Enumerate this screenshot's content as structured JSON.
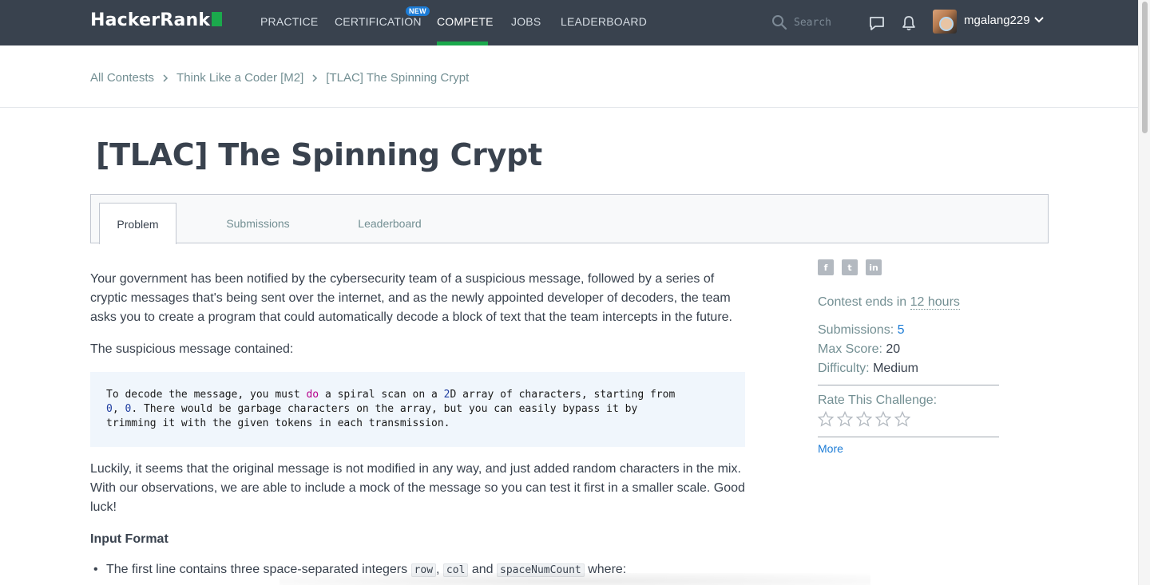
{
  "brand": {
    "name": "HackerRank",
    "accent": "#1ba94c"
  },
  "nav": {
    "items": [
      {
        "label": "PRACTICE"
      },
      {
        "label": "CERTIFICATION",
        "badge": "NEW"
      },
      {
        "label": "COMPETE",
        "active": true
      },
      {
        "label": "JOBS"
      },
      {
        "label": "LEADERBOARD"
      }
    ],
    "search_placeholder": "Search",
    "username": "mgalang229"
  },
  "breadcrumb": [
    "All Contests",
    "Think Like a Coder [M2]",
    "[TLAC] The Spinning Crypt"
  ],
  "page_title": "[TLAC] The Spinning Crypt",
  "tabs": [
    {
      "label": "Problem",
      "active": true
    },
    {
      "label": "Submissions"
    },
    {
      "label": "Leaderboard"
    }
  ],
  "problem": {
    "intro": "Your government has been notified by the cybersecurity team of a suspicious message, followed by a series of cryptic messages that's being sent over the internet, and as the newly appointed developer of decoders, the team asks you to create a program that could automatically decode a block of text that the team intercepts in the future.",
    "contained_label": "The suspicious message contained:",
    "code": {
      "p1": "To decode the message",
      "p2": ", you must ",
      "kw": "do",
      "p3": " a spiral scan on a ",
      "n2": "2",
      "p4": "D array of characters",
      "p5": ", starting from",
      "n0a": "0",
      "p6": ", ",
      "n0b": "0",
      "p7": ". There would be garbage characters on the array",
      "p8": ", but you can easily bypass it by",
      "p9": "trimming it with the given tokens in each transmission."
    },
    "luckily": "Luckily, it seems that the original message is not modified in any way, and just added random characters in the mix. With our observations, we are able to include a mock of the message so you can test it first in a smaller scale. Good luck!",
    "input_format_heading": "Input Format",
    "input_line_start": "The first line contains three space-separated integers",
    "code_row": "row",
    "code_col": "col",
    "and_word": "and",
    "code_space": "spaceNumCount",
    "where_word": "where:"
  },
  "sidebar": {
    "contest_ends_prefix": "Contest ends in ",
    "contest_ends_value": "12 hours",
    "submissions_label": "Submissions:",
    "submissions_value": "5",
    "max_score_label": "Max Score:",
    "max_score_value": "20",
    "difficulty_label": "Difficulty:",
    "difficulty_value": "Medium",
    "rate_label": "Rate This Challenge:",
    "more_label": "More",
    "share": [
      "facebook-icon",
      "twitter-icon",
      "linkedin-icon"
    ]
  }
}
